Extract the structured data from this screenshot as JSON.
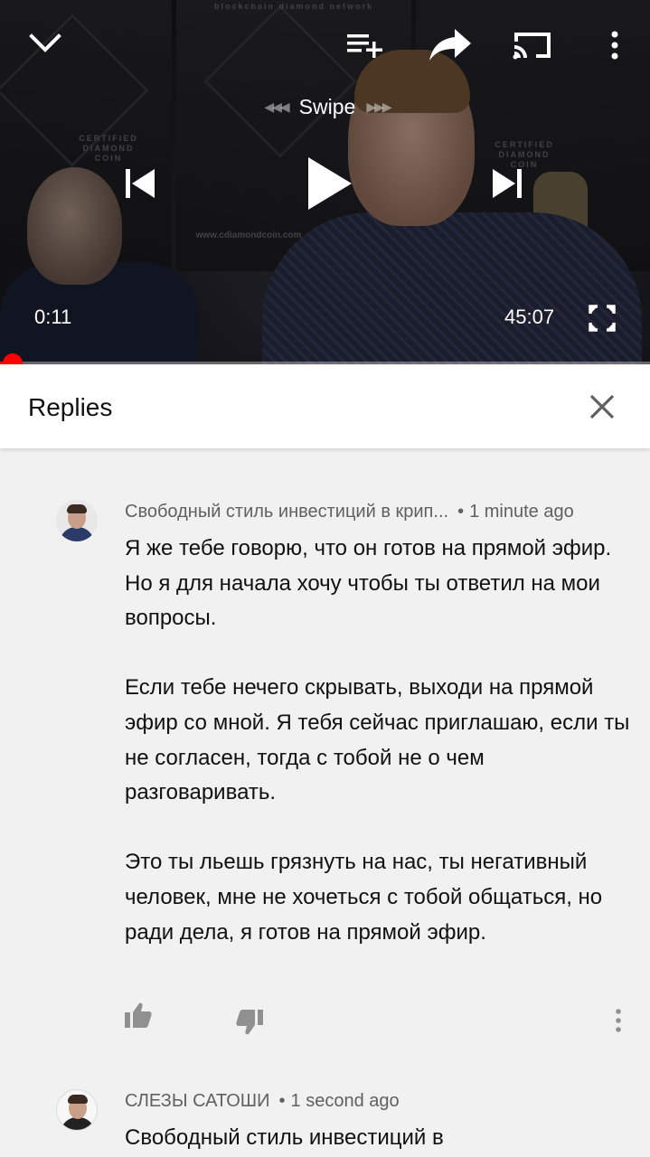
{
  "player": {
    "swipe_label": "Swipe",
    "current_time": "0:11",
    "duration": "45:07",
    "progress": 0.004,
    "accent_color": "#ff0000",
    "banner_lines": [
      "CERTIFIED",
      "DIAMOND",
      "COIN"
    ],
    "banner_top_text": "blockchain diamond network",
    "banner_url": "www.cdiamondcoin.com"
  },
  "icons": {
    "collapse": "chevron-down-icon",
    "add_to_queue": "playlist-add-icon",
    "share": "share-icon",
    "cast": "cast-icon",
    "more": "more-vert-icon",
    "previous": "skip-previous-icon",
    "play": "play-icon",
    "next": "skip-next-icon",
    "fullscreen": "fullscreen-icon",
    "close": "close-icon",
    "like": "thumb-up-icon",
    "dislike": "thumb-down-icon"
  },
  "replies": {
    "title": "Replies",
    "comments": [
      {
        "author": "Свободный стиль инвестиций в крип...",
        "time": "1 minute ago",
        "paragraphs": [
          "Я же тебе говорю, что он готов на прямой эфир. Но я для начала хочу чтобы ты ответил на мои вопросы.",
          "Если тебе нечего скрывать, выходи на прямой эфир со мной. Я тебя сейчас приглашаю, если ты не согласен, тогда с тобой не о чем разговаривать.",
          "Это ты льешь грязнуть на нас, ты негативный человек, мне не хочеться с тобой общаться, но ради дела, я готов на прямой эфир."
        ]
      },
      {
        "author": "СЛЕЗЫ САТОШИ",
        "time": "1 second ago",
        "paragraphs": [
          "Свободный стиль инвестиций в"
        ]
      }
    ]
  }
}
